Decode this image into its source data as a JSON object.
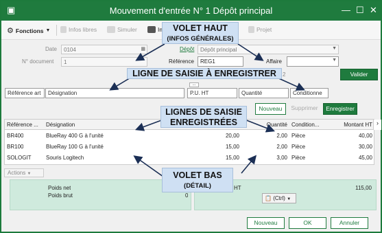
{
  "window": {
    "title": "Mouvement d'entrée N° 1 Dépôt principal"
  },
  "toolbar": {
    "fonctions": "Fonctions",
    "infos_libres": "Infos libres",
    "simuler": "Simuler",
    "imprimer": "Im",
    "projet": "Projet"
  },
  "header": {
    "date_label": "Date",
    "date_value": "0104",
    "num_label": "N° document",
    "num_value": "1",
    "depot_link": "Dépôt",
    "depot_value": "Dépôt principal",
    "reference_label": "Référence",
    "reference_value": "REG1",
    "affaire_label": "Affaire",
    "affaire_value": "",
    "extra_value": "2",
    "valider": "Valider"
  },
  "entry": {
    "reference_placeholder": "Référence art",
    "designation_placeholder": "Désignation",
    "pu_placeholder": "P.U. HT",
    "quantite_placeholder": "Quantité",
    "conditionnement_placeholder": "Conditionne",
    "ellipsis": "..."
  },
  "line_actions": {
    "nouveau": "Nouveau",
    "supprimer": "Supprimer",
    "enregistrer": "Enregistrer"
  },
  "table": {
    "columns": [
      "Référence ...",
      "Désignation",
      "Quantité",
      "Condition...",
      "Montant HT"
    ],
    "rows": [
      {
        "ref": "BR400",
        "designation": "BlueRay 400 G à l'unité",
        "pu": "20,00",
        "qte": "2,00",
        "cond": "Pièce",
        "montant": "40,00"
      },
      {
        "ref": "BR100",
        "designation": "BlueRay 100 G à l'unité",
        "pu": "15,00",
        "qte": "2,00",
        "cond": "Pièce",
        "montant": "30,00"
      },
      {
        "ref": "SOLOGIT",
        "designation": "Souris Logitech",
        "pu": "15,00",
        "qte": "3,00",
        "cond": "Pièce",
        "montant": "45,00"
      }
    ]
  },
  "bottom": {
    "actions": "Actions",
    "poids_net": "Poids net",
    "poids_brut": "Poids brut",
    "poids_brut_value": "0",
    "ht_label": "HT",
    "total_ht": "115,00",
    "ctrl": "(Ctrl)"
  },
  "footer": {
    "nouveau": "Nouveau",
    "ok": "OK",
    "annuler": "Annuler"
  },
  "callouts": {
    "volet_haut_1": "VOLET HAUT",
    "volet_haut_2": "INFOS GÉNÉRALES",
    "ligne_saisie": "LIGNE DE SAISIE À ENREGISTRER",
    "lignes_1": "LIGNES DE SAISIE",
    "lignes_2": "ENREGISTRÉES",
    "volet_bas_1": "VOLET BAS",
    "volet_bas_2": "DÉTAIL"
  },
  "colors": {
    "accent": "#1f7b3e",
    "callout": "#cfe0f3",
    "panel": "#cfeadd"
  }
}
